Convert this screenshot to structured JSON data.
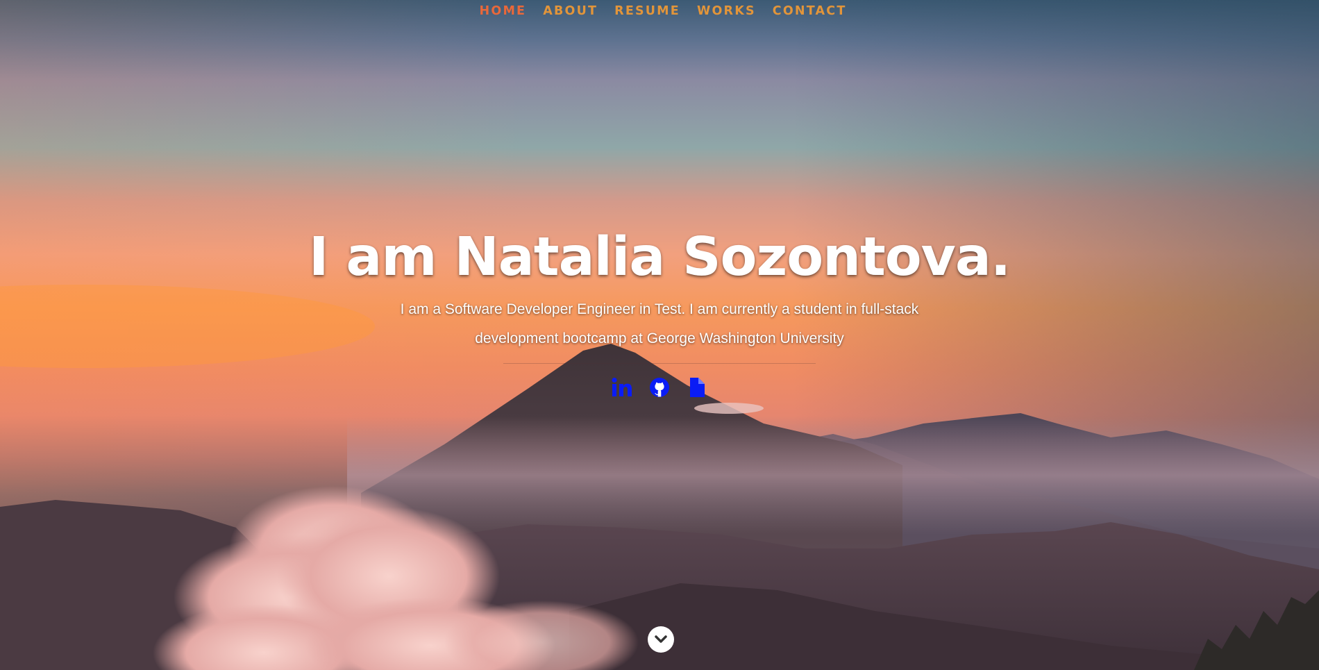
{
  "nav": {
    "items": [
      {
        "label": "HOME",
        "active": true
      },
      {
        "label": "ABOUT",
        "active": false
      },
      {
        "label": "RESUME",
        "active": false
      },
      {
        "label": "WORKS",
        "active": false
      },
      {
        "label": "CONTACT",
        "active": false
      }
    ]
  },
  "banner": {
    "headline": "I am Natalia Sozontova.",
    "tagline": "I am a Software Developer Engineer in Test. I am currently a student in full-stack development bootcamp at George Washington University"
  },
  "social": [
    {
      "icon": "linkedin-icon"
    },
    {
      "icon": "github-icon"
    },
    {
      "icon": "document-icon"
    }
  ],
  "colors": {
    "nav_text": "#e2953a",
    "nav_active": "#e9683a",
    "social_icon": "#0a1cf5",
    "headline": "#ffffff"
  }
}
